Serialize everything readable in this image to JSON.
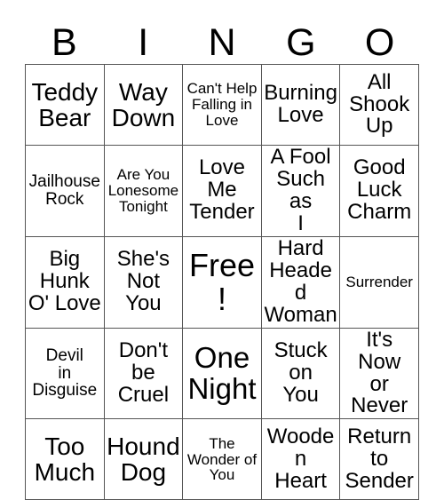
{
  "card": {
    "title": "BINGO",
    "header_letters": [
      "B",
      "I",
      "N",
      "G",
      "O"
    ],
    "free_space_label": "Free!",
    "grid_line_color": "#555555",
    "text_color": "#000000",
    "background_color": "#ffffff",
    "rows": [
      [
        {
          "label": "Teddy\nBear",
          "size": "lg",
          "free": false
        },
        {
          "label": "Way\nDown",
          "size": "lg",
          "free": false
        },
        {
          "label": "Can't Help\nFalling in\nLove",
          "size": "xs",
          "free": false
        },
        {
          "label": "Burning\nLove",
          "size": "md",
          "free": false
        },
        {
          "label": "All\nShook\nUp",
          "size": "md",
          "free": false
        }
      ],
      [
        {
          "label": "Jailhouse\nRock",
          "size": "sm",
          "free": false
        },
        {
          "label": "Are You\nLonesome\nTonight",
          "size": "xs",
          "free": false
        },
        {
          "label": "Love\nMe\nTender",
          "size": "md",
          "free": false
        },
        {
          "label": "A Fool\nSuch as\nI",
          "size": "md",
          "free": false
        },
        {
          "label": "Good\nLuck\nCharm",
          "size": "md",
          "free": false
        }
      ],
      [
        {
          "label": "Big\nHunk\nO' Love",
          "size": "md",
          "free": false
        },
        {
          "label": "She's\nNot\nYou",
          "size": "md",
          "free": false
        },
        {
          "label": "Free!",
          "size": "xl",
          "free": true
        },
        {
          "label": "Hard\nHeaded\nWoman",
          "size": "md",
          "free": false
        },
        {
          "label": "Surrender",
          "size": "xs",
          "free": false
        }
      ],
      [
        {
          "label": "Devil\nin\nDisguise",
          "size": "sm",
          "free": false
        },
        {
          "label": "Don't\nbe\nCruel",
          "size": "md",
          "free": false
        },
        {
          "label": "One\nNight",
          "size": "xl",
          "free": false
        },
        {
          "label": "Stuck\non\nYou",
          "size": "md",
          "free": false
        },
        {
          "label": "It's Now\nor\nNever",
          "size": "md",
          "free": false
        }
      ],
      [
        {
          "label": "Too\nMuch",
          "size": "lg",
          "free": false
        },
        {
          "label": "Hound\nDog",
          "size": "lg",
          "free": false
        },
        {
          "label": "The\nWonder of\nYou",
          "size": "xs",
          "free": false
        },
        {
          "label": "Wooden\nHeart",
          "size": "md",
          "free": false
        },
        {
          "label": "Return\nto\nSender",
          "size": "md",
          "free": false
        }
      ]
    ]
  }
}
